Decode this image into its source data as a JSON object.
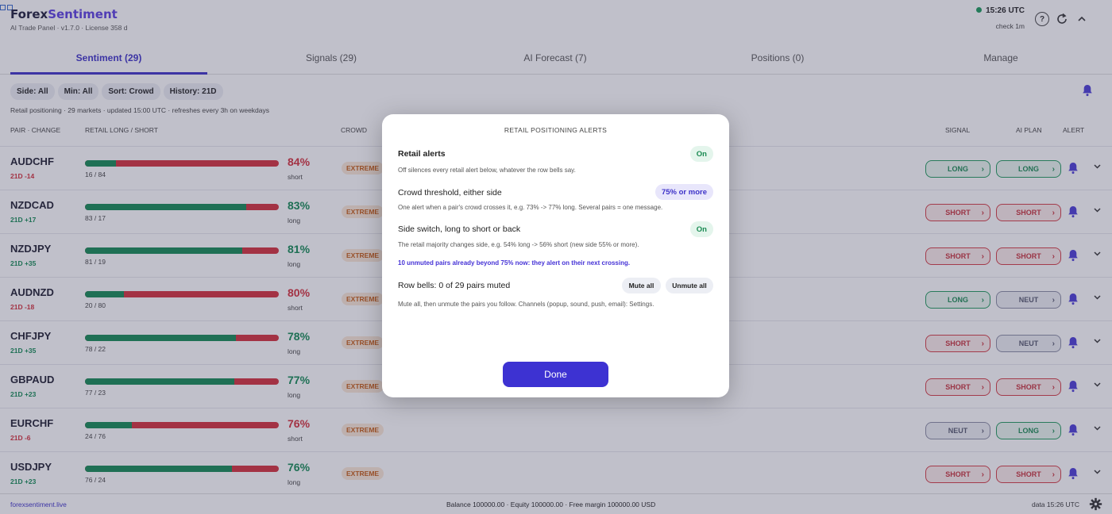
{
  "app": {
    "brand_1": "Forex",
    "brand_2": "Sentiment",
    "subtitle": "AI Trade Panel · v1.7.0 · License 358 d",
    "time": "15:26 UTC",
    "check": "check 1m",
    "help_glyph": "?"
  },
  "tabs": [
    {
      "label": "Sentiment (29)"
    },
    {
      "label": "Signals (29)"
    },
    {
      "label": "AI Forecast (7)"
    },
    {
      "label": "Positions (0)"
    },
    {
      "label": "Manage"
    }
  ],
  "filters": [
    "Side: All",
    "Min: All",
    "Sort: Crowd",
    "History: 21D"
  ],
  "meta": "Retail positioning · 29 markets · updated 15:00 UTC · refreshes every 3h on weekdays",
  "columns": {
    "pair": "PAIR · CHANGE",
    "retail": "RETAIL LONG / SHORT",
    "crowd": "CROWD",
    "signal": "SIGNAL",
    "ai_plan": "AI PLAN",
    "alert": "ALERT"
  },
  "colors": {
    "long": "#128a53",
    "short": "#d42f3a",
    "accent": "#3d32c8"
  },
  "rows": [
    {
      "pair": "AUDCHF",
      "change": "21D -14",
      "change_dir": "neg",
      "long": 16,
      "ratio": "16 / 84",
      "pct": "84%",
      "side": "short",
      "crowd": "EXTREME",
      "signal": "LONG",
      "plan": "LONG"
    },
    {
      "pair": "NZDCAD",
      "change": "21D +17",
      "change_dir": "pos",
      "long": 83,
      "ratio": "83 / 17",
      "pct": "83%",
      "side": "long",
      "crowd": "EXTREME",
      "signal": "SHORT",
      "plan": "SHORT"
    },
    {
      "pair": "NZDJPY",
      "change": "21D +35",
      "change_dir": "pos",
      "long": 81,
      "ratio": "81 / 19",
      "pct": "81%",
      "side": "long",
      "crowd": "EXTREME",
      "signal": "SHORT",
      "plan": "SHORT"
    },
    {
      "pair": "AUDNZD",
      "change": "21D -18",
      "change_dir": "neg",
      "long": 20,
      "ratio": "20 / 80",
      "pct": "80%",
      "side": "short",
      "crowd": "EXTREME",
      "signal": "LONG",
      "plan": "NEUT"
    },
    {
      "pair": "CHFJPY",
      "change": "21D +35",
      "change_dir": "pos",
      "long": 78,
      "ratio": "78 / 22",
      "pct": "78%",
      "side": "long",
      "crowd": "EXTREME",
      "signal": "SHORT",
      "plan": "NEUT"
    },
    {
      "pair": "GBPAUD",
      "change": "21D +23",
      "change_dir": "pos",
      "long": 77,
      "ratio": "77 / 23",
      "pct": "77%",
      "side": "long",
      "crowd": "EXTREME",
      "signal": "SHORT",
      "plan": "SHORT"
    },
    {
      "pair": "EURCHF",
      "change": "21D -6",
      "change_dir": "neg",
      "long": 24,
      "ratio": "24 / 76",
      "pct": "76%",
      "side": "short",
      "crowd": "EXTREME",
      "signal": "NEUT",
      "plan": "LONG"
    },
    {
      "pair": "USDJPY",
      "change": "21D +23",
      "change_dir": "pos",
      "long": 76,
      "ratio": "76 / 24",
      "pct": "76%",
      "side": "long",
      "crowd": "EXTREME",
      "signal": "SHORT",
      "plan": "SHORT"
    }
  ],
  "footer": {
    "site": "forexsentiment.live",
    "balance": "Balance 100000.00 · Equity 100000.00 · Free margin 100000.00 USD",
    "data": "data 15:26 UTC"
  },
  "modal": {
    "title": "RETAIL POSITIONING ALERTS",
    "retail_label": "Retail alerts",
    "retail_state": "On",
    "retail_desc": "Off silences every retail alert below, whatever the row bells say.",
    "threshold_label": "Crowd threshold, either side",
    "threshold_value": "75% or more",
    "threshold_desc": "One alert when a pair's crowd crosses it, e.g. 73% -> 77% long. Several pairs = one message.",
    "switch_label": "Side switch, long to short or back",
    "switch_state": "On",
    "switch_desc": "The retail majority changes side, e.g. 54% long -> 56% short (new side 55% or more).",
    "note": "10 unmuted pairs already beyond 75% now: they alert on their next crossing.",
    "bells_label": "Row bells: 0 of 29 pairs muted",
    "mute_all": "Mute all",
    "unmute_all": "Unmute all",
    "bells_desc": "Mute all, then unmute the pairs you follow. Channels (popup, sound, push, email): Settings.",
    "done": "Done"
  }
}
